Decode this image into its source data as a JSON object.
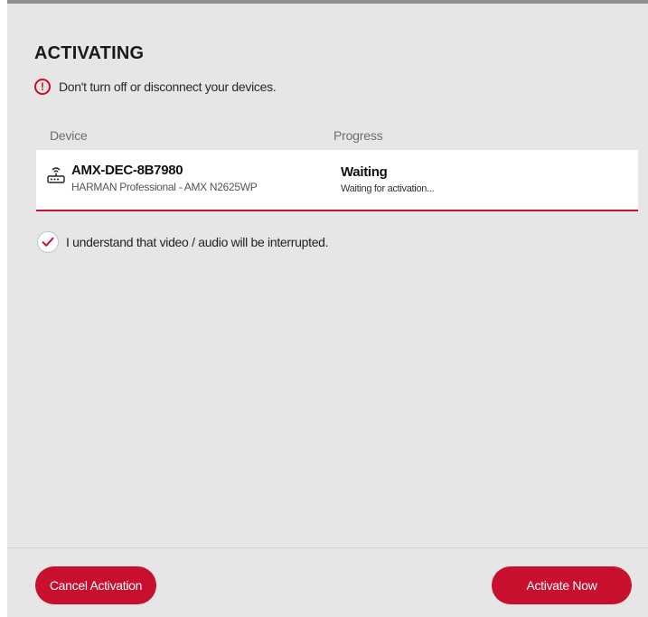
{
  "dialog": {
    "title": "ACTIVATING",
    "warning": "Don't turn off or disconnect your devices.",
    "columns": {
      "device": "Device",
      "progress": "Progress"
    },
    "device": {
      "name": "AMX-DEC-8B7980",
      "model": "HARMAN Professional - AMX N2625WP",
      "icon": "router-icon",
      "status": "Waiting",
      "status_detail": "Waiting for activation..."
    },
    "acknowledge": {
      "label": "I understand that video / audio will be interrupted.",
      "checked": true
    },
    "buttons": {
      "cancel": "Cancel Activation",
      "activate": "Activate Now"
    }
  },
  "colors": {
    "accent": "#c8102e",
    "background": "#e6e6e6",
    "row_background": "#ffffff"
  }
}
